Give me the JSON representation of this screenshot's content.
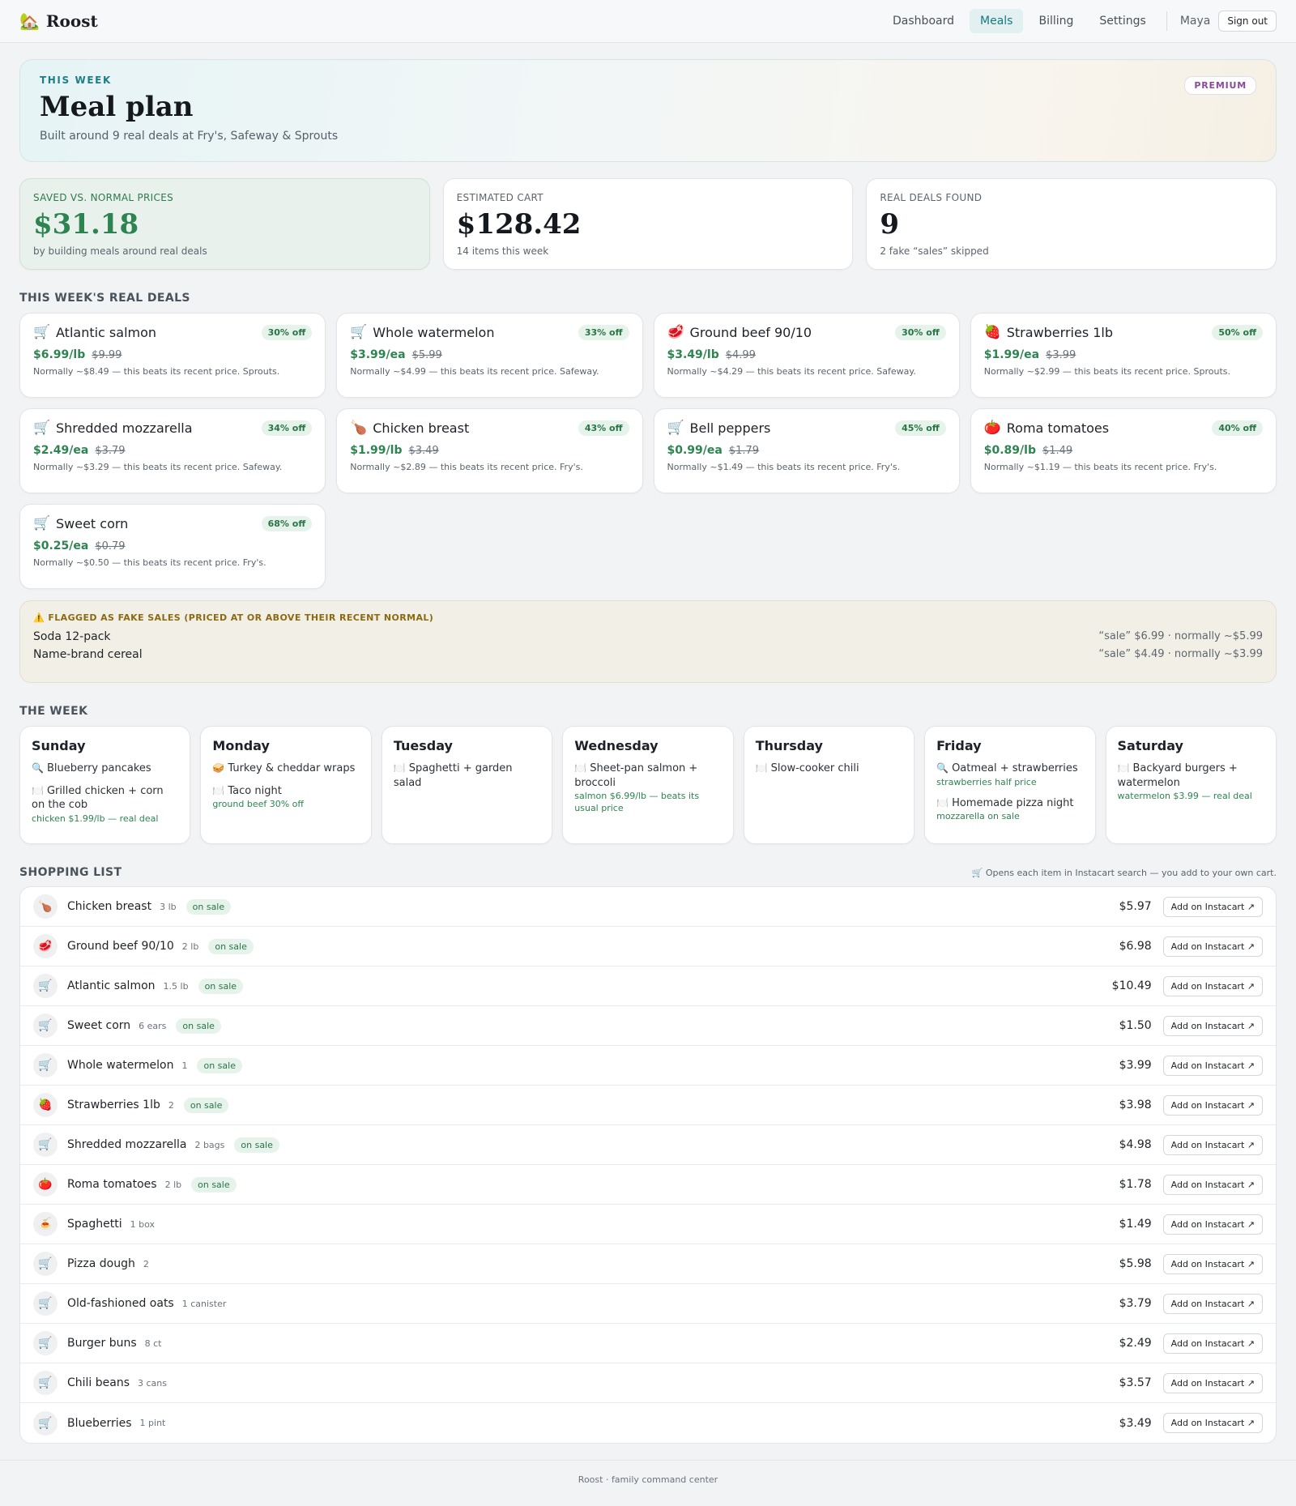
{
  "app": {
    "name": "Roost",
    "logo_icon": "house-icon"
  },
  "nav": {
    "items": [
      {
        "label": "Dashboard"
      },
      {
        "label": "Meals",
        "active": true
      },
      {
        "label": "Billing"
      },
      {
        "label": "Settings"
      }
    ],
    "user": "Maya",
    "signout": "Sign out"
  },
  "hero": {
    "eyebrow": "THIS WEEK",
    "title": "Meal plan",
    "subtitle": "Built around 9 real deals at Fry's, Safeway & Sprouts",
    "badge": "PREMIUM"
  },
  "stats": [
    {
      "label": "SAVED VS. NORMAL PRICES",
      "value": "$31.18",
      "note": "by building meals around real deals"
    },
    {
      "label": "ESTIMATED CART",
      "value": "$128.42",
      "note": "14 items this week"
    },
    {
      "label": "REAL DEALS FOUND",
      "value": "9",
      "note": "2 fake “sales” skipped"
    }
  ],
  "deals_title": "THIS WEEK'S REAL DEALS",
  "deals": [
    {
      "icon": "🛒",
      "name": "Atlantic salmon",
      "off": "30% off",
      "now": "$6.99/lb",
      "was": "$9.99",
      "note": "Normally ~$8.49 — this beats its recent price. Sprouts."
    },
    {
      "icon": "🛒",
      "name": "Whole watermelon",
      "off": "33% off",
      "now": "$3.99/ea",
      "was": "$5.99",
      "note": "Normally ~$4.99 — this beats its recent price. Safeway."
    },
    {
      "icon": "🥩",
      "name": "Ground beef 90/10",
      "off": "30% off",
      "now": "$3.49/lb",
      "was": "$4.99",
      "note": "Normally ~$4.29 — this beats its recent price. Safeway."
    },
    {
      "icon": "🍓",
      "name": "Strawberries 1lb",
      "off": "50% off",
      "now": "$1.99/ea",
      "was": "$3.99",
      "note": "Normally ~$2.99 — this beats its recent price. Sprouts."
    },
    {
      "icon": "🛒",
      "name": "Shredded mozzarella",
      "off": "34% off",
      "now": "$2.49/ea",
      "was": "$3.79",
      "note": "Normally ~$3.29 — this beats its recent price. Safeway."
    },
    {
      "icon": "🍗",
      "name": "Chicken breast",
      "off": "43% off",
      "now": "$1.99/lb",
      "was": "$3.49",
      "note": "Normally ~$2.89 — this beats its recent price. Fry's."
    },
    {
      "icon": "🛒",
      "name": "Bell peppers",
      "off": "45% off",
      "now": "$0.99/ea",
      "was": "$1.79",
      "note": "Normally ~$1.49 — this beats its recent price. Fry's."
    },
    {
      "icon": "🍅",
      "name": "Roma tomatoes",
      "off": "40% off",
      "now": "$0.89/lb",
      "was": "$1.49",
      "note": "Normally ~$1.19 — this beats its recent price. Fry's."
    },
    {
      "icon": "🛒",
      "name": "Sweet corn",
      "off": "68% off",
      "now": "$0.25/ea",
      "was": "$0.79",
      "note": "Normally ~$0.50 — this beats its recent price. Fry's."
    }
  ],
  "fake": {
    "title": "FLAGGED AS FAKE SALES (PRICED AT OR ABOVE THEIR RECENT NORMAL)",
    "icon": "⚠️",
    "items": [
      {
        "name": "Soda 12-pack",
        "price": "“sale” $6.99 · normally ~$5.99"
      },
      {
        "name": "Name-brand cereal",
        "price": "“sale” $4.49 · normally ~$3.99"
      }
    ]
  },
  "week_title": "THE WEEK",
  "week": [
    {
      "day": "Sunday",
      "meals": [
        {
          "icon": "🔍",
          "name": "Blueberry pancakes"
        },
        {
          "icon": "🍽️",
          "name": "Grilled chicken + corn on the cob",
          "note": "chicken $1.99/lb — real deal"
        }
      ]
    },
    {
      "day": "Monday",
      "meals": [
        {
          "icon": "🥪",
          "name": "Turkey & cheddar wraps"
        },
        {
          "icon": "🍽️",
          "name": "Taco night",
          "note": "ground beef 30% off"
        }
      ]
    },
    {
      "day": "Tuesday",
      "meals": [
        {
          "icon": "🍽️",
          "name": "Spaghetti + garden salad"
        }
      ]
    },
    {
      "day": "Wednesday",
      "meals": [
        {
          "icon": "🍽️",
          "name": "Sheet-pan salmon + broccoli",
          "note": "salmon $6.99/lb — beats its usual price"
        }
      ]
    },
    {
      "day": "Thursday",
      "meals": [
        {
          "icon": "🍽️",
          "name": "Slow-cooker chili"
        }
      ]
    },
    {
      "day": "Friday",
      "meals": [
        {
          "icon": "🔍",
          "name": "Oatmeal + strawberries",
          "note": "strawberries half price"
        },
        {
          "icon": "🍽️",
          "name": "Homemade pizza night",
          "note": "mozzarella on sale"
        }
      ]
    },
    {
      "day": "Saturday",
      "meals": [
        {
          "icon": "🍽️",
          "name": "Backyard burgers + watermelon",
          "note": "watermelon $3.99 — real deal"
        }
      ]
    }
  ],
  "shopping": {
    "title": "SHOPPING LIST",
    "hint": "🛒 Opens each item in Instacart search — you add to your own cart.",
    "button": "Add on Instacart ↗",
    "items": [
      {
        "icon": "🍗",
        "name": "Chicken breast",
        "qty": "3 lb",
        "tag": "on sale",
        "price": "$5.97"
      },
      {
        "icon": "🥩",
        "name": "Ground beef 90/10",
        "qty": "2 lb",
        "tag": "on sale",
        "price": "$6.98"
      },
      {
        "icon": "🛒",
        "name": "Atlantic salmon",
        "qty": "1.5 lb",
        "tag": "on sale",
        "price": "$10.49"
      },
      {
        "icon": "🛒",
        "name": "Sweet corn",
        "qty": "6 ears",
        "tag": "on sale",
        "price": "$1.50"
      },
      {
        "icon": "🛒",
        "name": "Whole watermelon",
        "qty": "1",
        "tag": "on sale",
        "price": "$3.99"
      },
      {
        "icon": "🍓",
        "name": "Strawberries 1lb",
        "qty": "2",
        "tag": "on sale",
        "price": "$3.98"
      },
      {
        "icon": "🛒",
        "name": "Shredded mozzarella",
        "qty": "2 bags",
        "tag": "on sale",
        "price": "$4.98"
      },
      {
        "icon": "🍅",
        "name": "Roma tomatoes",
        "qty": "2 lb",
        "tag": "on sale",
        "price": "$1.78"
      },
      {
        "icon": "🍝",
        "name": "Spaghetti",
        "qty": "1 box",
        "tag": "",
        "price": "$1.49"
      },
      {
        "icon": "🛒",
        "name": "Pizza dough",
        "qty": "2",
        "tag": "",
        "price": "$5.98"
      },
      {
        "icon": "🛒",
        "name": "Old-fashioned oats",
        "qty": "1 canister",
        "tag": "",
        "price": "$3.79"
      },
      {
        "icon": "🛒",
        "name": "Burger buns",
        "qty": "8 ct",
        "tag": "",
        "price": "$2.49"
      },
      {
        "icon": "🛒",
        "name": "Chili beans",
        "qty": "3 cans",
        "tag": "",
        "price": "$3.57"
      },
      {
        "icon": "🛒",
        "name": "Blueberries",
        "qty": "1 pint",
        "tag": "",
        "price": "$3.49"
      }
    ]
  },
  "footer": "Roost · family command center"
}
